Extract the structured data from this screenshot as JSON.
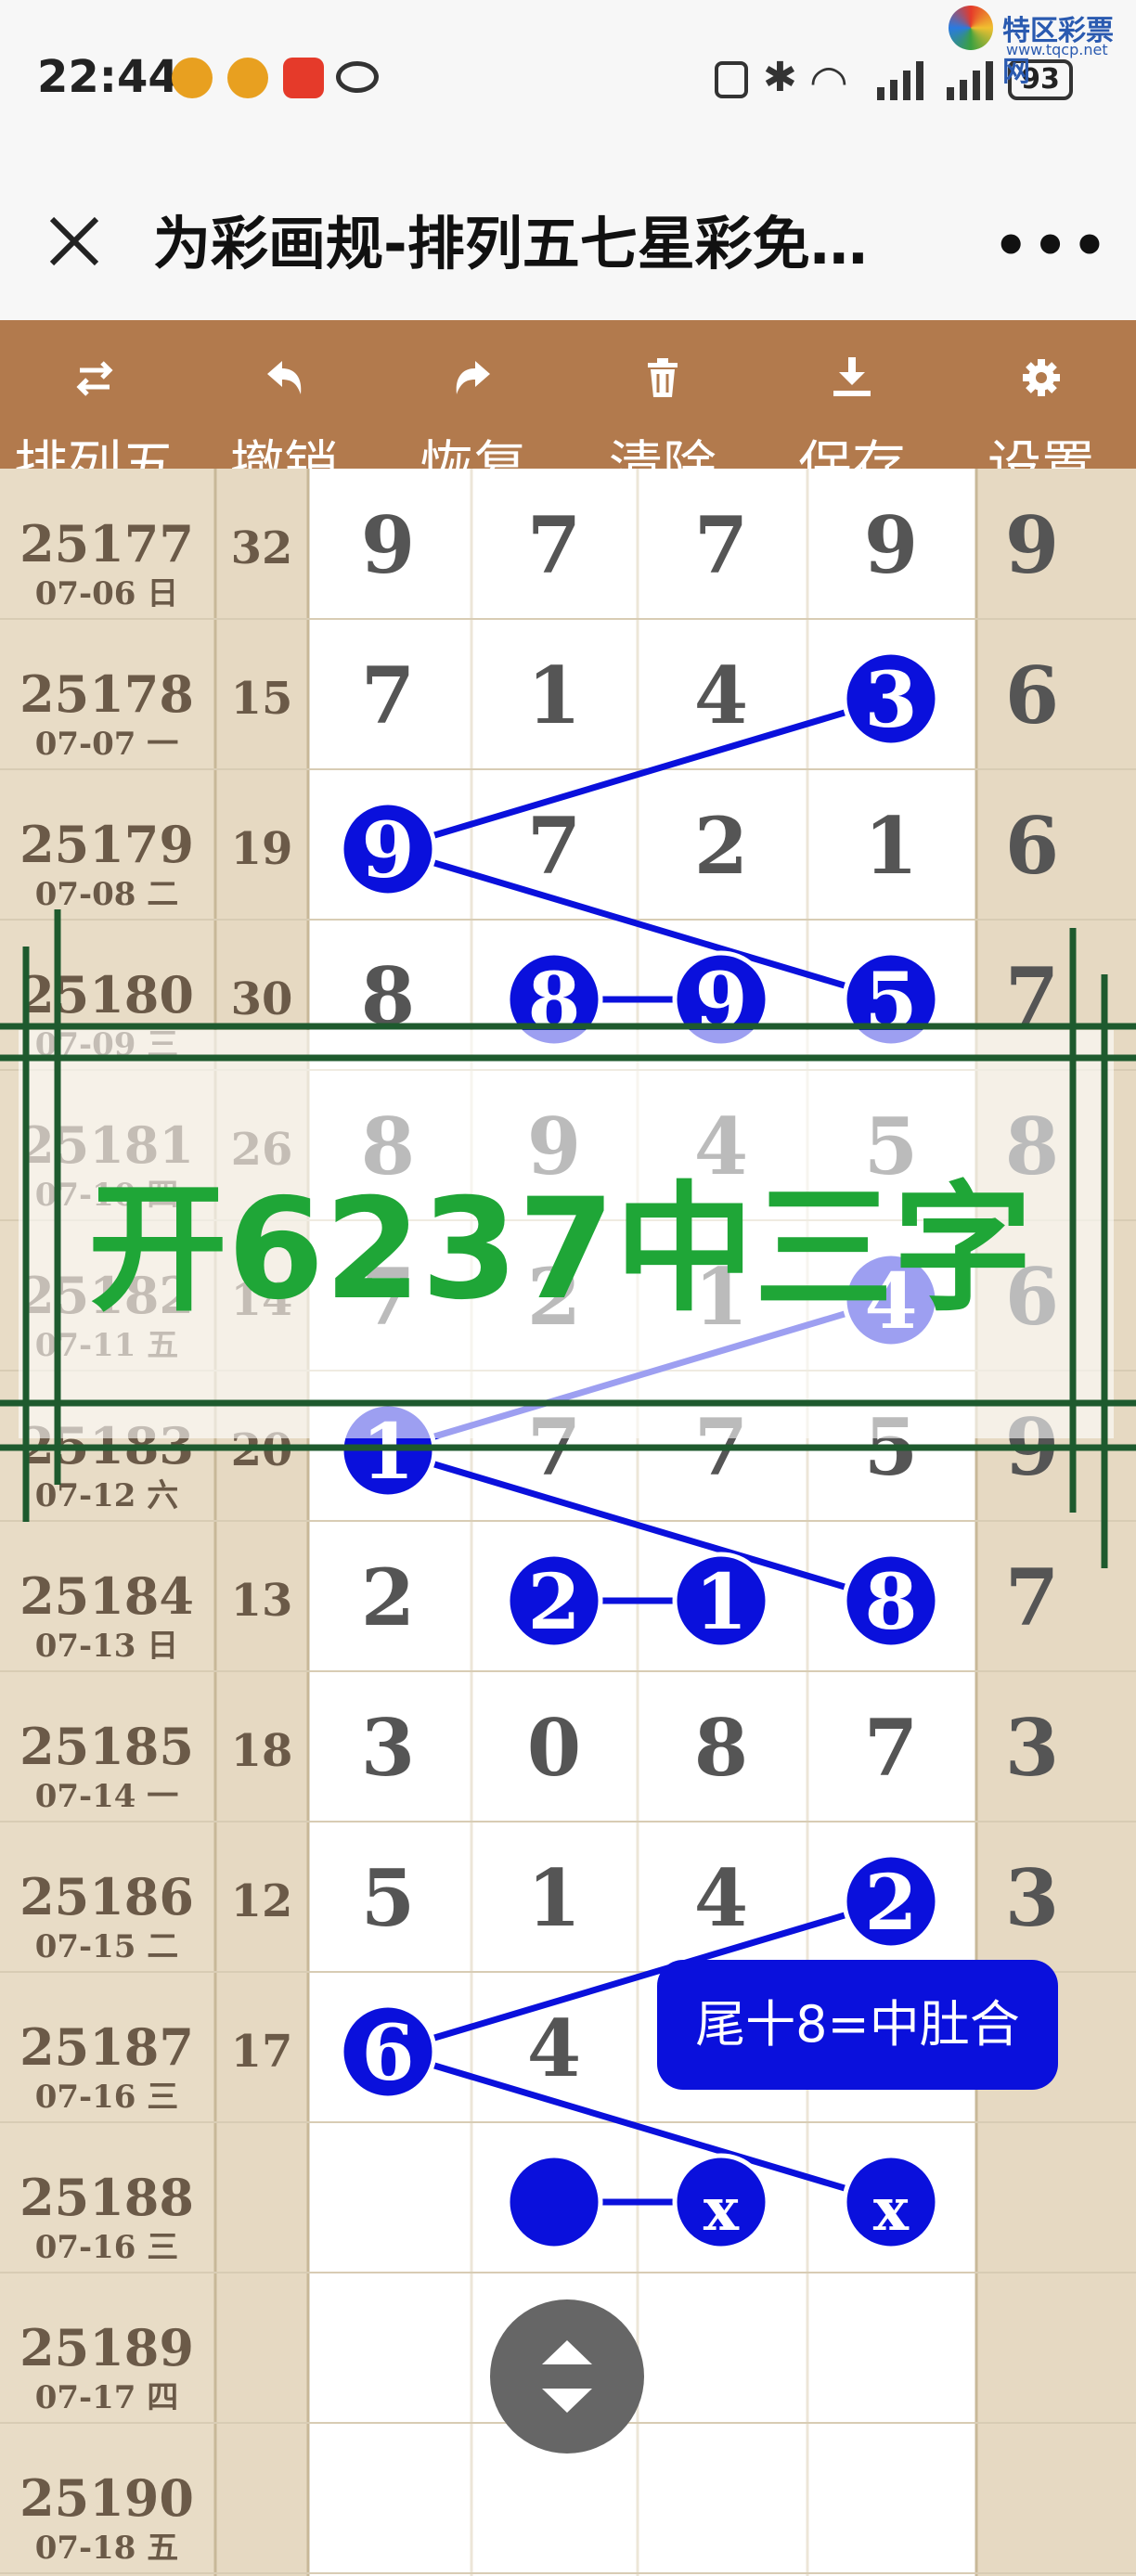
{
  "status": {
    "time": "22:44",
    "battery": "93",
    "brand": "特区彩票网",
    "brand_url": "www.tqcp.net"
  },
  "title": {
    "text": "为彩画规-排列五七星彩免…"
  },
  "toolbar": [
    {
      "id": "switch",
      "label": "排列五",
      "icon": "swap-icon"
    },
    {
      "id": "undo",
      "label": "撤销",
      "icon": "undo-icon"
    },
    {
      "id": "redo",
      "label": "恢复",
      "icon": "redo-icon"
    },
    {
      "id": "clear",
      "label": "清除",
      "icon": "trash-icon"
    },
    {
      "id": "save",
      "label": "保存",
      "icon": "download-icon"
    },
    {
      "id": "settings",
      "label": "设置",
      "icon": "gear-icon"
    }
  ],
  "rows": [
    {
      "issue": "25177",
      "date": "07-06 日",
      "sum": "32",
      "d": [
        "9",
        "7",
        "7",
        "9",
        "9"
      ]
    },
    {
      "issue": "25178",
      "date": "07-07 一",
      "sum": "15",
      "d": [
        "7",
        "1",
        "4",
        "3",
        "6"
      ]
    },
    {
      "issue": "25179",
      "date": "07-08 二",
      "sum": "19",
      "d": [
        "9",
        "7",
        "2",
        "1",
        "6"
      ]
    },
    {
      "issue": "25180",
      "date": "07-09 三",
      "sum": "30",
      "d": [
        "8",
        "8",
        "9",
        "5",
        "7"
      ]
    },
    {
      "issue": "25181",
      "date": "07-10 四",
      "sum": "26",
      "d": [
        "8",
        "9",
        "4",
        "5",
        "8"
      ]
    },
    {
      "issue": "25182",
      "date": "07-11 五",
      "sum": "14",
      "d": [
        "7",
        "2",
        "1",
        "4",
        "6"
      ]
    },
    {
      "issue": "25183",
      "date": "07-12 六",
      "sum": "20",
      "d": [
        "1",
        "7",
        "7",
        "5",
        "9"
      ]
    },
    {
      "issue": "25184",
      "date": "07-13 日",
      "sum": "13",
      "d": [
        "2",
        "2",
        "1",
        "8",
        "7"
      ]
    },
    {
      "issue": "25185",
      "date": "07-14 一",
      "sum": "18",
      "d": [
        "3",
        "0",
        "8",
        "7",
        "3"
      ]
    },
    {
      "issue": "25186",
      "date": "07-15 二",
      "sum": "12",
      "d": [
        "5",
        "1",
        "4",
        "2",
        "3"
      ]
    },
    {
      "issue": "25187",
      "date": "07-16 三",
      "sum": "17",
      "d": [
        "6",
        "4",
        "",
        "",
        ""
      ]
    },
    {
      "issue": "25188",
      "date": "07-16 三",
      "sum": "",
      "d": [
        "",
        "",
        "",
        "",
        ""
      ]
    },
    {
      "issue": "25189",
      "date": "07-17 四",
      "sum": "",
      "d": [
        "",
        "",
        "",
        "",
        ""
      ]
    },
    {
      "issue": "25190",
      "date": "07-18 五",
      "sum": "",
      "d": [
        "",
        "",
        "",
        "",
        ""
      ]
    }
  ],
  "circles": [
    {
      "row": 1,
      "col": 3,
      "text": "3"
    },
    {
      "row": 2,
      "col": 0,
      "text": "9"
    },
    {
      "row": 3,
      "col": 1,
      "text": "8"
    },
    {
      "row": 3,
      "col": 2,
      "text": "9"
    },
    {
      "row": 3,
      "col": 3,
      "text": "5"
    },
    {
      "row": 5,
      "col": 3,
      "text": "4"
    },
    {
      "row": 6,
      "col": 0,
      "text": "1"
    },
    {
      "row": 7,
      "col": 1,
      "text": "2"
    },
    {
      "row": 7,
      "col": 2,
      "text": "1"
    },
    {
      "row": 7,
      "col": 3,
      "text": "8"
    },
    {
      "row": 9,
      "col": 3,
      "text": "2"
    },
    {
      "row": 10,
      "col": 0,
      "text": "6"
    },
    {
      "row": 11,
      "col": 1,
      "text": ""
    },
    {
      "row": 11,
      "col": 2,
      "text": "x"
    },
    {
      "row": 11,
      "col": 3,
      "text": "x"
    }
  ],
  "lines": [
    [
      0,
      1
    ],
    [
      1,
      4
    ],
    [
      2,
      3
    ],
    [
      5,
      6
    ],
    [
      6,
      9
    ],
    [
      7,
      8
    ],
    [
      10,
      11
    ],
    [
      11,
      14
    ],
    [
      12,
      13
    ]
  ],
  "hidden_cells": [
    [
      10,
      2
    ],
    [
      10,
      3
    ],
    [
      10,
      4
    ]
  ],
  "watermark": {
    "text": "开6237中三字"
  },
  "tooltip": {
    "text": "尾十8=中肚合"
  },
  "colors": {
    "circle": "#0a10dc",
    "toolbar": "#b27a4d",
    "watermark": "#1fa637",
    "frame": "#1e5a2e",
    "tooltip": "#0a10dc"
  }
}
